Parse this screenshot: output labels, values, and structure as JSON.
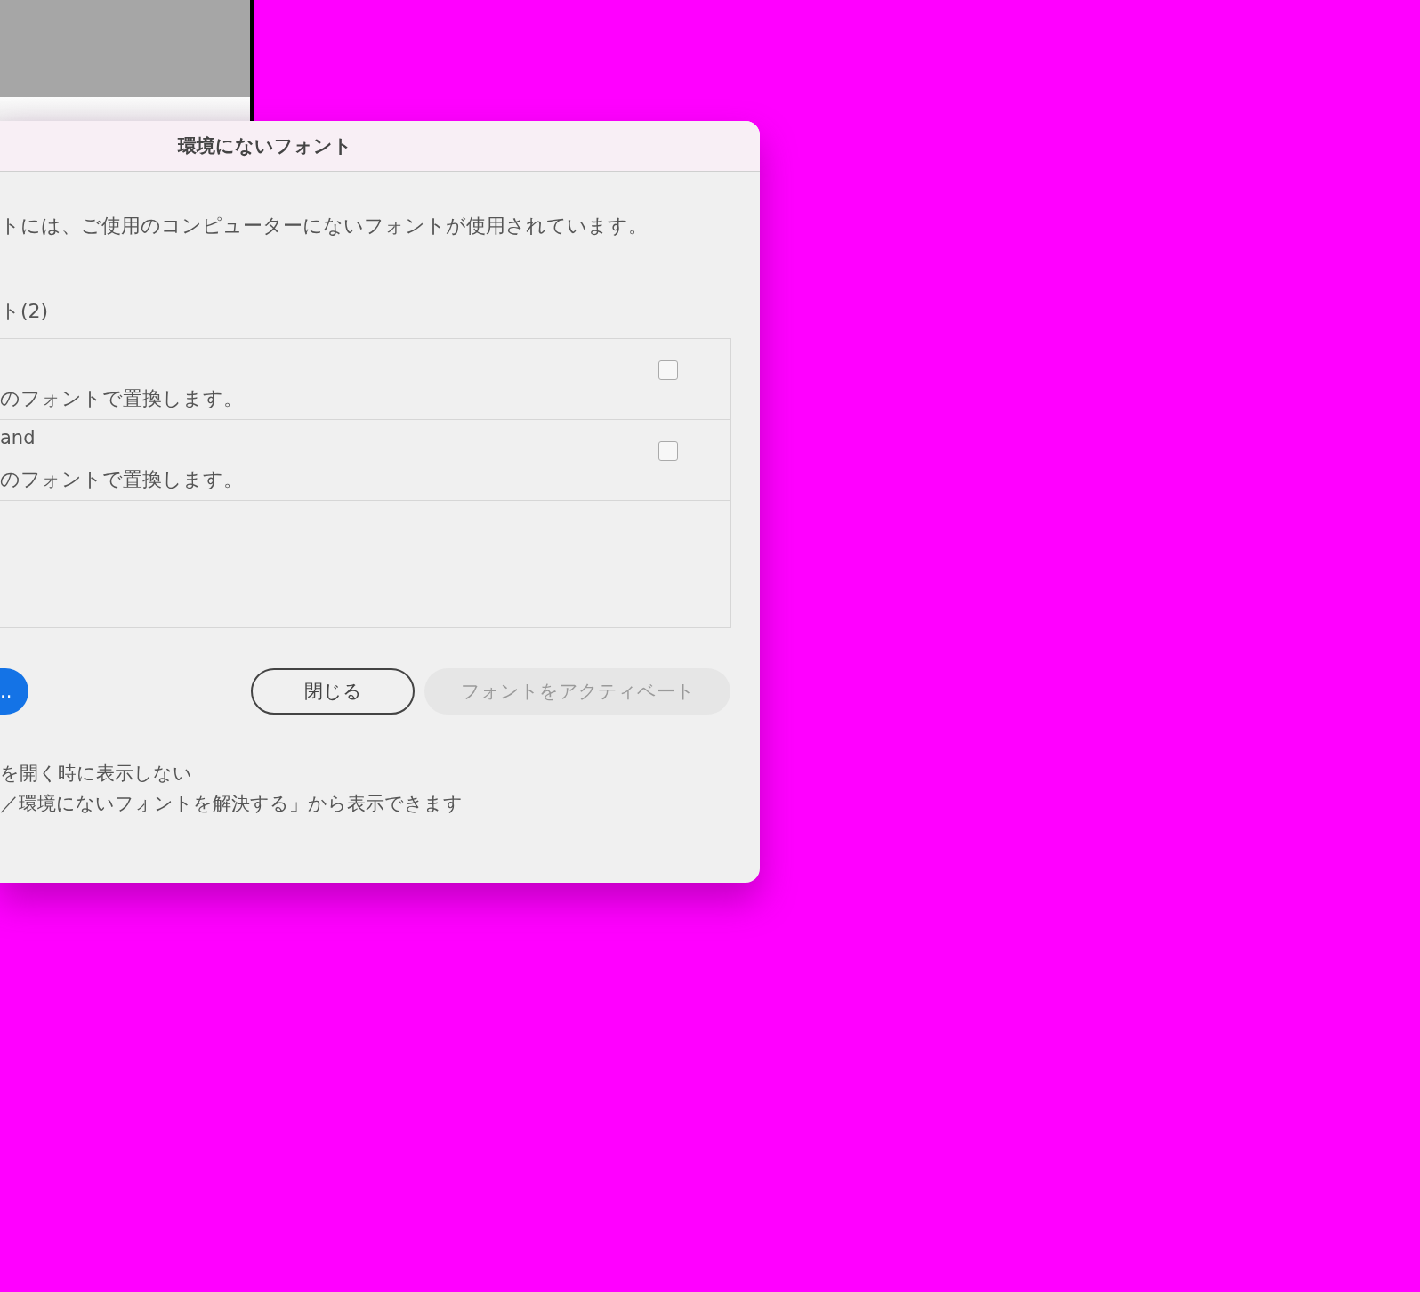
{
  "dialog": {
    "title": "環境にないフォント",
    "description": "トには、ご使用のコンピューターにないフォントが使用されています。",
    "section_label": "ト(2)",
    "fonts": [
      {
        "note": "のフォントで置換します。",
        "checked": false
      },
      {
        "name": "and",
        "note": "のフォントで置換します。",
        "checked": false
      }
    ],
    "buttons": [
      {
        "kind": "primary",
        "label": "..",
        "disabled": false
      },
      {
        "kind": "secondary",
        "label": "閉じる",
        "disabled": false
      },
      {
        "kind": "secondary",
        "label": "フォントをアクティベート",
        "disabled": true
      }
    ],
    "footer": {
      "option_label": "を開く時に表示しない",
      "hint": "／環境にないフォントを解決する」から表示できます"
    }
  }
}
